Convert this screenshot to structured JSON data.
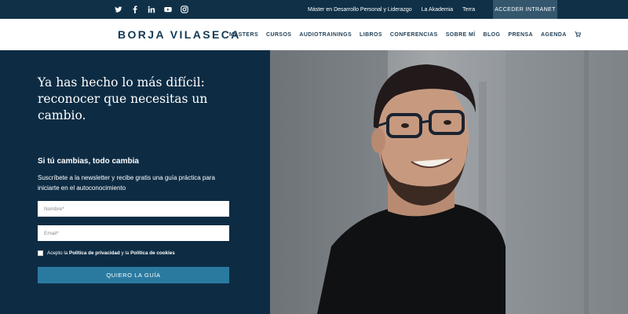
{
  "topbar": {
    "social_icons": [
      "twitter-icon",
      "facebook-icon",
      "linkedin-icon",
      "youtube-icon",
      "instagram-icon"
    ],
    "links": [
      "Máster en Desarrollo Personal y Liderazgo",
      "La Akademia",
      "Terra"
    ],
    "intranet_button": "ACCEDER INTRANET"
  },
  "header": {
    "logo": "BORJA VILASECA",
    "nav": [
      "MÁSTERS",
      "CURSOS",
      "AUDIOTRAININGS",
      "LIBROS",
      "CONFERENCIAS",
      "SOBRE MÍ",
      "BLOG",
      "PRENSA",
      "AGENDA"
    ],
    "cart_icon": "cart-icon"
  },
  "hero": {
    "headline": "Ya has hecho lo más difícil: reconocer que necesitas un cambio.",
    "subhead": "Si tú cambias, todo cambia",
    "description": "Suscríbete a la newsletter y recibe gratis una guía práctica para iniciarte en el autoconocimiento",
    "form": {
      "name_placeholder": "Nombre*",
      "email_placeholder": "Email*",
      "consent_prefix": "Acepto la ",
      "consent_privacy": "Política de privacidad",
      "consent_middle": " y la ",
      "consent_cookies": "Política de cookies",
      "submit_label": "QUIERO LA GUÍA"
    }
  },
  "colors": {
    "topbar": "#0f3047",
    "hero_panel": "#0d2c44",
    "button": "#2a7aa0",
    "logo": "#123a55"
  }
}
